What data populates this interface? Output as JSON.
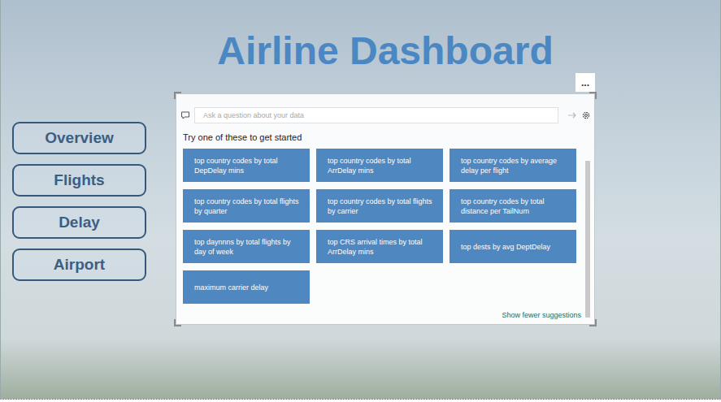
{
  "title": "Airline Dashboard",
  "nav": {
    "items": [
      {
        "label": "Overview"
      },
      {
        "label": "Flights"
      },
      {
        "label": "Delay"
      },
      {
        "label": "Airport"
      }
    ]
  },
  "visual": {
    "more_button": "...",
    "input": {
      "placeholder": "Ask a question about your data"
    },
    "prompt": "Try one of these to get started",
    "suggestions": [
      "top country codes by total DepDelay mins",
      "top country codes by total ArrDelay mins",
      "top country codes by average delay per flight",
      "top country codes by total flights by quarter",
      "top country codes by total flights by carrier",
      "top country codes by total distance per TailNum",
      "top daynnns by total flights by day of week",
      "top CRS arrival times by total ArrDelay mins",
      "top dests by avg DeptDelay",
      "maximum carrier delay"
    ],
    "show_fewer": "Show fewer suggestions"
  }
}
